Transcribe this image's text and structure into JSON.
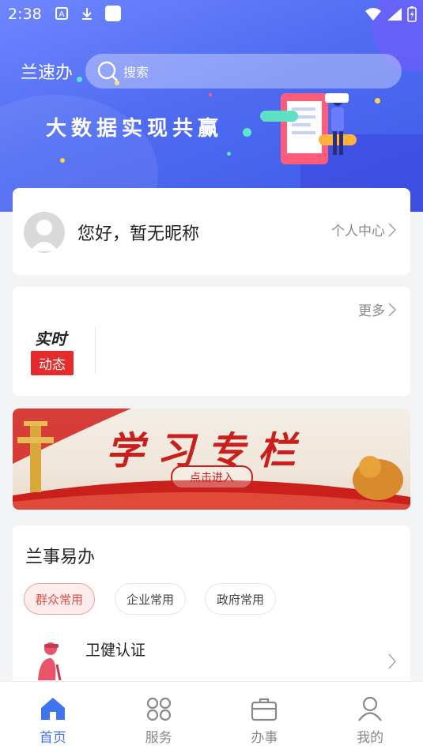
{
  "status_bar": {
    "time": "2:38"
  },
  "header": {
    "city": "兰速办",
    "search_placeholder": "搜索",
    "banner_text": "大数据实现共赢"
  },
  "profile": {
    "greeting": "您好，暂无昵称",
    "link": "个人中心"
  },
  "news": {
    "more": "更多",
    "label_top": "实时",
    "label_badge": "动态"
  },
  "study_banner": {
    "title": "学习专栏",
    "button": "点击进入"
  },
  "services": {
    "title": "兰事易办",
    "tabs": [
      "群众常用",
      "企业常用",
      "政府常用"
    ],
    "active_tab": "群众常用",
    "items": [
      {
        "label": "卫健认证"
      }
    ]
  },
  "tabbar": {
    "items": [
      {
        "label": "首页",
        "icon": "home-icon",
        "active": true
      },
      {
        "label": "服务",
        "icon": "grid-icon",
        "active": false
      },
      {
        "label": "办事",
        "icon": "briefcase-icon",
        "active": false
      },
      {
        "label": "我的",
        "icon": "user-icon",
        "active": false
      }
    ]
  },
  "colors": {
    "primary": "#3f74ee",
    "header_blue": "#4f6cf2",
    "accent_red": "#e52b2b",
    "chip_active": "#e54d42"
  }
}
